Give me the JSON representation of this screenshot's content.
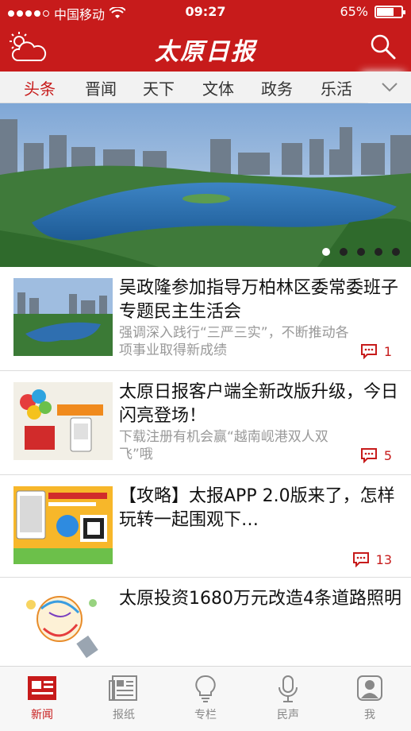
{
  "status_bar": {
    "carrier": "中国移动",
    "time": "09:27",
    "battery": "65%",
    "battery_level": 0.65
  },
  "header": {
    "logo": "太原日报",
    "left_icon": "weather-icon",
    "right_icon": "search-icon"
  },
  "tabs": [
    {
      "label": "头条",
      "active": true
    },
    {
      "label": "晋闻"
    },
    {
      "label": "天下"
    },
    {
      "label": "文体"
    },
    {
      "label": "政务"
    },
    {
      "label": "乐活"
    }
  ],
  "banner": {
    "slide_count": 5,
    "active_slide": 1
  },
  "news": [
    {
      "title": "吴政隆参加指导万柏林区委常委班子专题民主生活会",
      "subtitle": "强调深入践行“三严三实”，不断推动各项事业取得新成绩",
      "comments": "1"
    },
    {
      "title": "太原日报客户端全新改版升级，今日闪亮登场！",
      "subtitle": "下载注册有机会赢“越南岘港双人双飞”哦",
      "comments": "5"
    },
    {
      "title": "【攻略】太报APP 2.0版来了，怎样玩转一起围观下…",
      "subtitle": "",
      "comments": "13"
    },
    {
      "title": "太原投资1680万元改造4条道路照明",
      "subtitle": "",
      "comments": ""
    }
  ],
  "bottom_nav": [
    {
      "label": "新闻",
      "icon": "newspaper-icon",
      "active": true
    },
    {
      "label": "报纸",
      "icon": "paper-icon"
    },
    {
      "label": "专栏",
      "icon": "bulb-icon"
    },
    {
      "label": "民声",
      "icon": "microphone-icon"
    },
    {
      "label": "我",
      "icon": "profile-icon"
    }
  ],
  "colors": {
    "brand_red": "#c71b1b",
    "tab_background": "#f2f2f2",
    "subtitle_gray": "#999999"
  }
}
